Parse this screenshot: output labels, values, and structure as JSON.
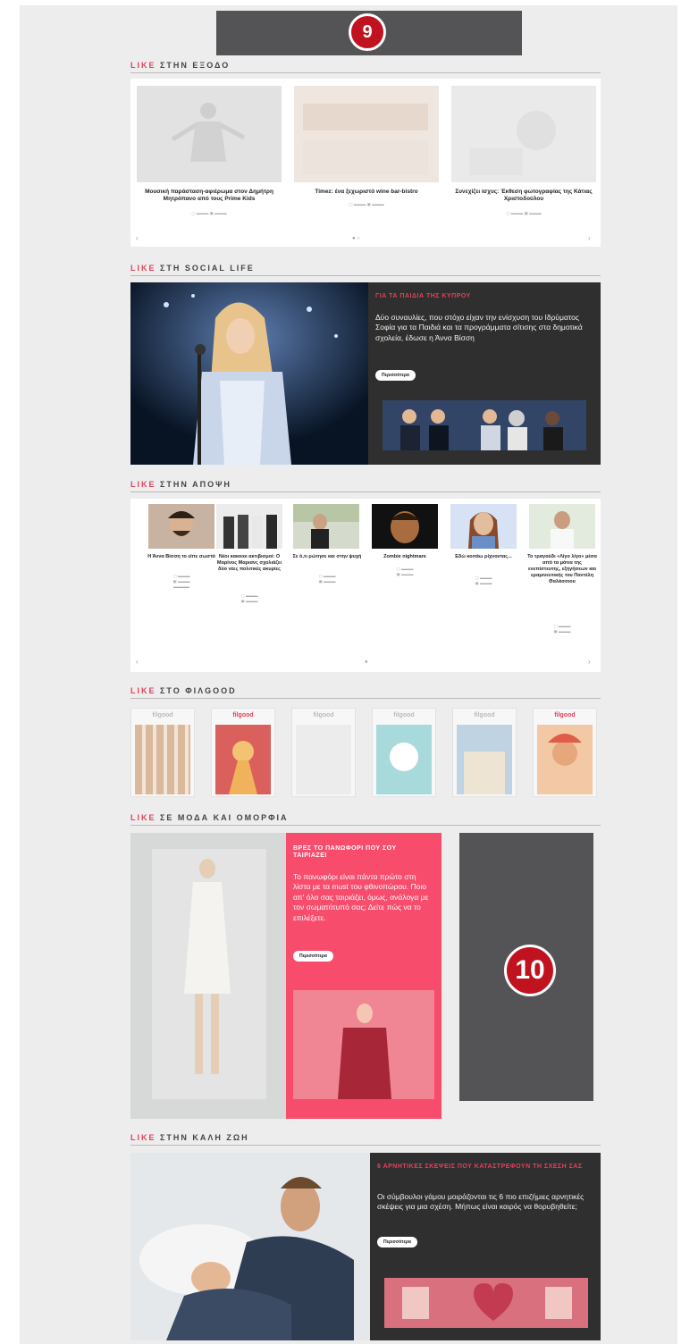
{
  "badges": {
    "top": "9",
    "side": "10"
  },
  "sections": {
    "exodo": {
      "like": "LIKE",
      "title": " ΣΤΗΝ ΕΞΟΔΟ",
      "cards": [
        {
          "caption": "Μουσική παράσταση-αφιέρωμα στον Δημήτρη Μητρόπανο από τους Prime Kids"
        },
        {
          "caption": "Timez: ένα ξεχωριστό wine bar-bistro"
        },
        {
          "caption": "Συνεχίζει ίσχυς: Έκθεση φωτογραφίας της Κάτιας Χριστοδούλου"
        }
      ],
      "prev": "‹",
      "next": "›",
      "dots": "● ○"
    },
    "social": {
      "like": "LIKE",
      "title": " ΣΤΗ SOCIAL LIFE",
      "kicker": "ΓΙΑ ΤΑ ΠΑΙΔΙΑ ΤΗΣ ΚΥΠΡΟΥ",
      "text": "Δύο συναυλίες, που στόχο είχαν την ενίσχυση του Ιδρύματος Σοφία για τα Παιδιά και τα προγράμματα σίτισης στα δημοτικά σχολεία, έδωσε η Άννα Βίσση",
      "button": "Περισσότερα"
    },
    "apopsi": {
      "like": "LIKE",
      "title": " ΣΤΗΝ ΑΠΟΨΗ",
      "items": [
        {
          "caption": "Η Άννα Βίσση το είπε σωστά"
        },
        {
          "caption": "Νέοι κακοιοι ακτιβισμοί: Ο Μαρίνος Μαριανς σχολιάζει δύο νέες πολιτικές ακυρίες"
        },
        {
          "caption": "Σε ό,τι ρώτησε και στην ψυχή"
        },
        {
          "caption": "Zombie nightmare"
        },
        {
          "caption": "Εδώ κοιτάω ρίχνοντας..."
        },
        {
          "caption": "Το τραγούδι «Λίγο λίγο» μέσα από τα μάτια της ενεπίστευτης, εξηγήσεων και εραμινευτικής του Παντέλη Θαλάσσιου"
        }
      ],
      "prev": "‹",
      "next": "›",
      "dots": "●"
    },
    "filgood": {
      "like": "LIKE",
      "title": " ΣΤΟ ΦΙΛGOOD",
      "logos": [
        "filgood",
        "filgood",
        "filgood",
        "filgood",
        "filgood",
        "filgood"
      ]
    },
    "moda": {
      "like": "LIKE",
      "title": " ΣΕ ΜΟΔΑ ΚΑΙ ΟΜΟΡΦΙΑ",
      "kicker": "ΒΡΕΣ ΤΟ ΠΑΝΩΦΟΡΙ ΠΟΥ ΣΟΥ ΤΑΙΡΙΑΖΕΙ",
      "text": "Το πανωφόρι είναι πάντα πρώτο στη λίστα με τα must του φθινοπώρου. Ποιο απ' όλα σας ταιριάζει, όμως, ανάλογα με τον σωματότυπό σας; Δείτε πώς να το επιλέξετε.",
      "button": "Περισσότερα"
    },
    "kali": {
      "like": "LIKE",
      "title": " ΣΤΗΝ ΚΑΛΗ ΖΩΗ",
      "kicker": "6 ΑΡΝΗΤΙΚΕΣ ΣΚΕΨΕΙΣ ΠΟΥ ΚΑΤΑΣΤΡΕΦΟΥΝ ΤΗ ΣΧΕΣΗ ΣΑΣ",
      "text": "Οι σύμβουλοι γάμου μοιράζονται τις 6 πιο επιζήμιες αρνητικές σκέψεις για μια σχέση. Μήπως είναι καιρός να θορυβηθείτε;",
      "button": "Περισσότερα"
    }
  }
}
